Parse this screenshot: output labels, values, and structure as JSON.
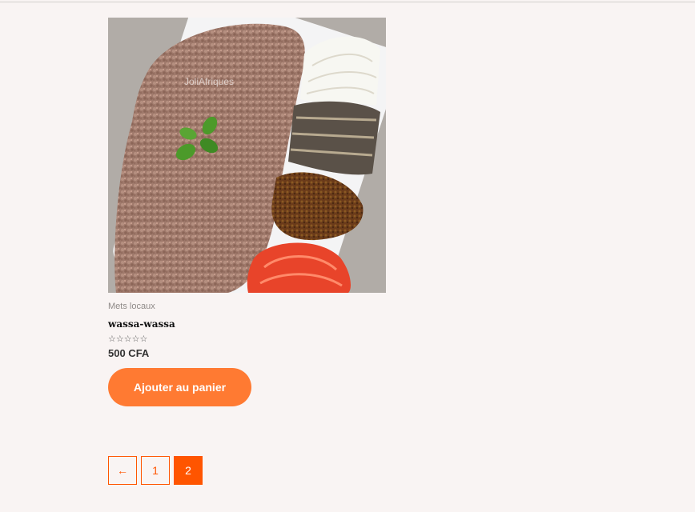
{
  "product": {
    "category": "Mets locaux",
    "name": "wassa-wassa",
    "rating_stars": "☆☆☆☆☆",
    "rating_value": 0,
    "price": "500 CFA",
    "add_to_cart_label": "Ajouter au panier",
    "watermark": "JoliAfriques"
  },
  "pagination": {
    "prev_label": "←",
    "pages": [
      "1",
      "2"
    ],
    "current_page": "2"
  },
  "colors": {
    "accent": "#ff5500",
    "button": "#ff7a32",
    "background": "#f9f4f3"
  }
}
